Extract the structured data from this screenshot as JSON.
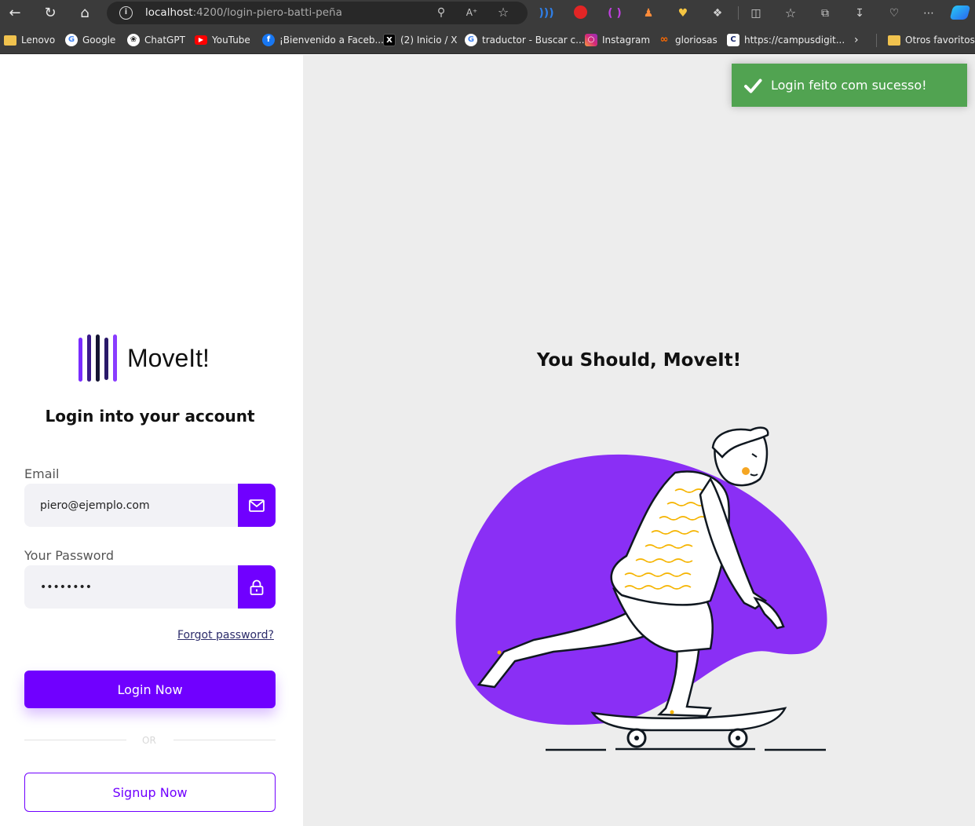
{
  "browser": {
    "url_host": "localhost",
    "url_path": ":4200/login-piero-batti-peña",
    "bookmarks": [
      {
        "label": "Lenovo",
        "icon": "folder-icon"
      },
      {
        "label": "Google",
        "icon": "google-icon"
      },
      {
        "label": "ChatGPT",
        "icon": "chatgpt-icon"
      },
      {
        "label": "YouTube",
        "icon": "youtube-icon"
      },
      {
        "label": "¡Bienvenido a Faceb...",
        "icon": "facebook-icon"
      },
      {
        "label": "(2) Inicio / X",
        "icon": "x-icon"
      },
      {
        "label": "traductor - Buscar c...",
        "icon": "google-icon"
      },
      {
        "label": "Instagram",
        "icon": "instagram-icon"
      },
      {
        "label": "gloriosas",
        "icon": "link-icon"
      },
      {
        "label": "https://campusdigit...",
        "icon": "campus-icon"
      }
    ],
    "other_bookmarks": "Otros favoritos"
  },
  "app": {
    "logo_text": "MoveIt!",
    "login_title": "Login into your account",
    "email": {
      "label": "Email",
      "value": "piero@ejemplo.com"
    },
    "password": {
      "label": "Your Password",
      "value": "••••••••"
    },
    "forgot": "Forgot password?",
    "login_button": "Login Now",
    "or": "OR",
    "signup_button": "Signup Now",
    "slogan": "You Should, MoveIt!",
    "toast": "Login feito com sucesso!",
    "colors": {
      "accent": "#7000ff",
      "toast": "#51a351",
      "panel": "#ededed"
    }
  }
}
